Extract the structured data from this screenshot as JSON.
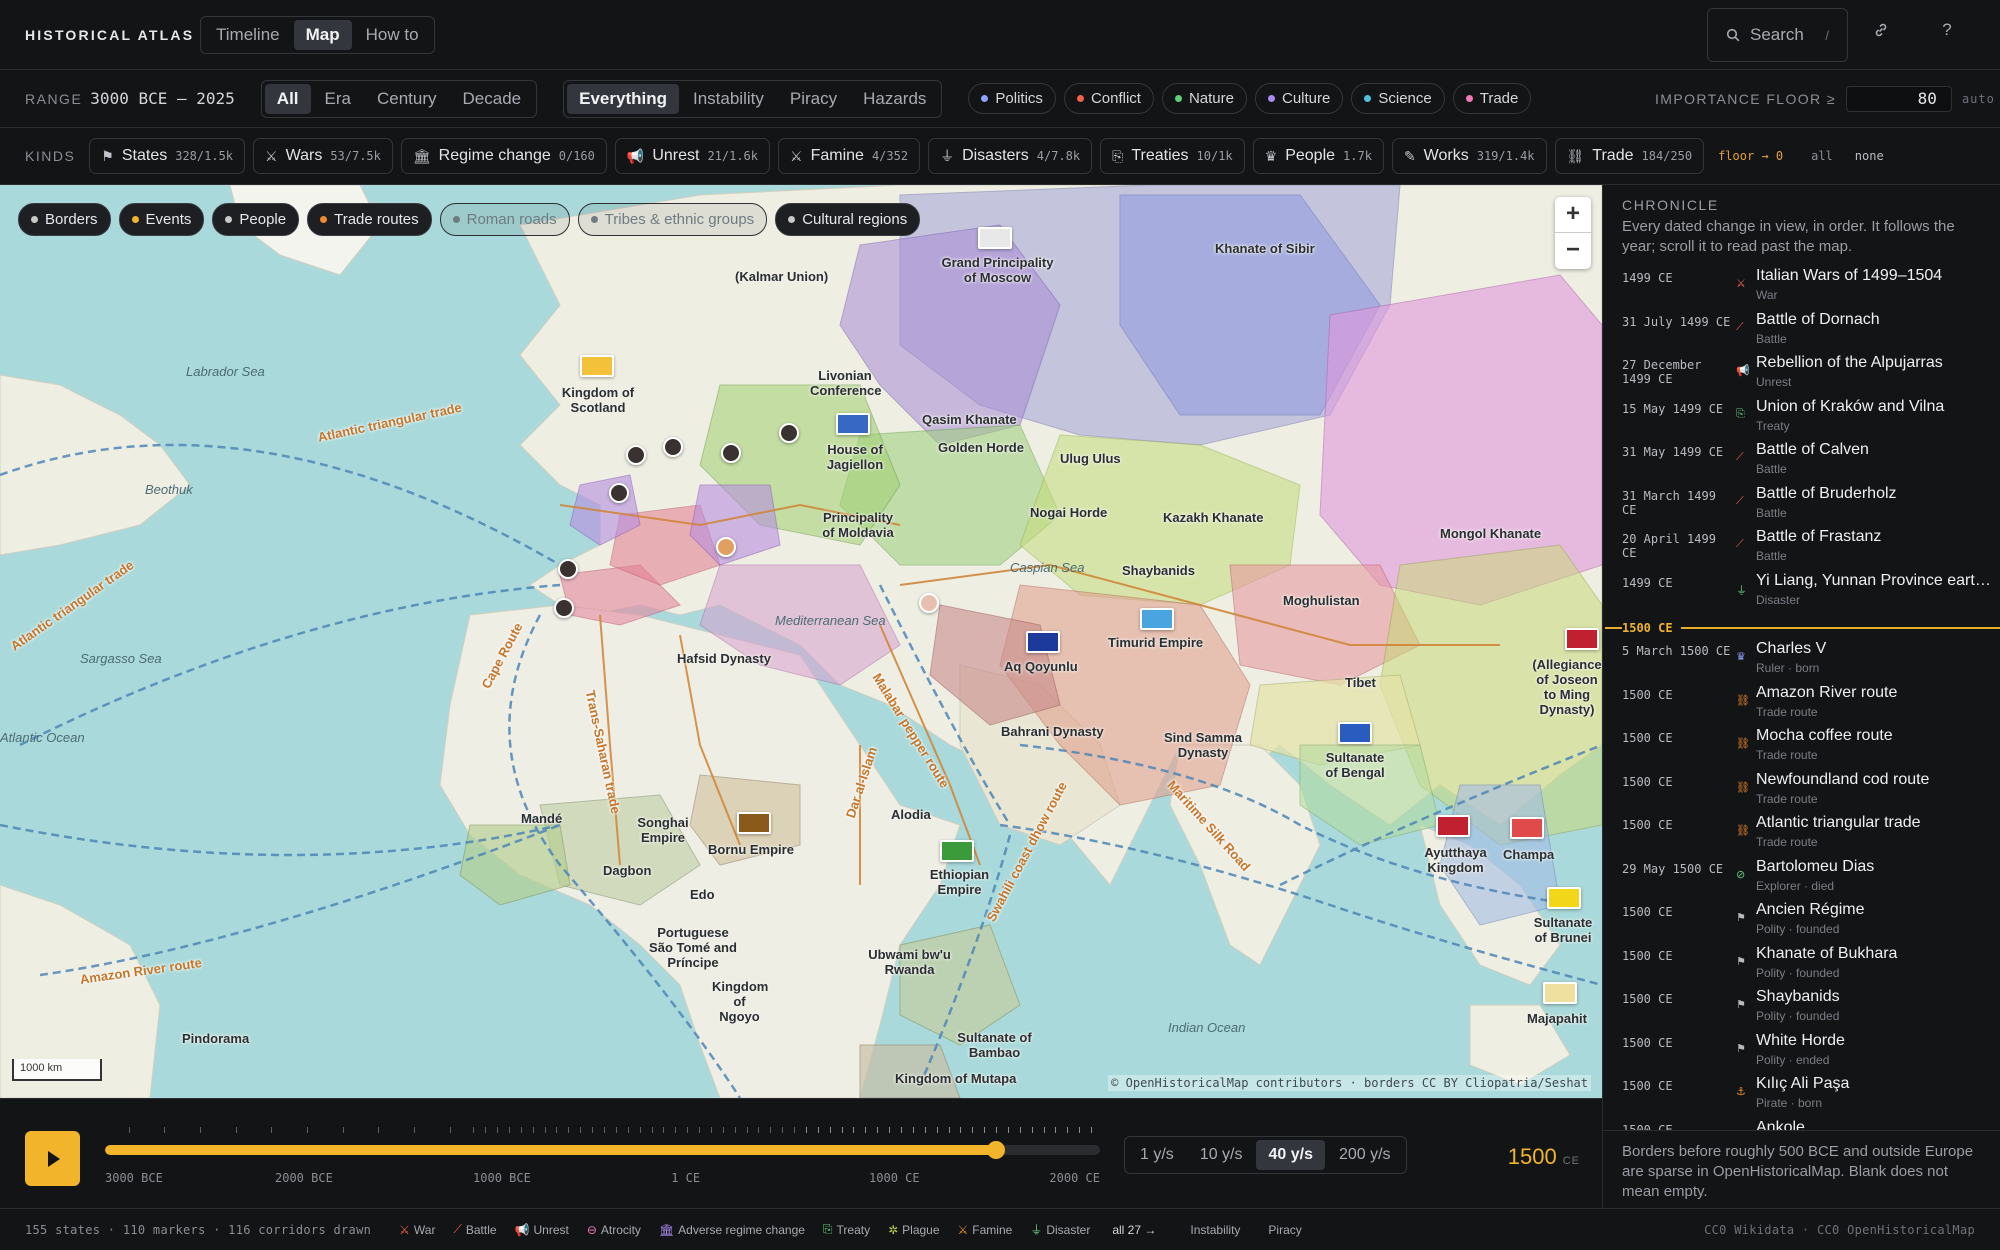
{
  "header": {
    "brand": "HISTORICAL ATLAS",
    "views": [
      "Timeline",
      "Map",
      "How to"
    ],
    "active_view": "Map",
    "search_placeholder": "Search",
    "search_shortcut": "/"
  },
  "range": {
    "label": "RANGE",
    "value": "3000 BCE — 2025",
    "granularity": [
      "All",
      "Era",
      "Century",
      "Decade"
    ],
    "active_granularity": "All",
    "lenses": [
      "Everything",
      "Instability",
      "Piracy",
      "Hazards"
    ],
    "active_lens": "Everything",
    "themes": [
      {
        "label": "Politics",
        "color": "#8ea2ff"
      },
      {
        "label": "Conflict",
        "color": "#f0624d"
      },
      {
        "label": "Nature",
        "color": "#5fcf7c"
      },
      {
        "label": "Culture",
        "color": "#a98bf0"
      },
      {
        "label": "Science",
        "color": "#4cc3d9"
      },
      {
        "label": "Trade",
        "color": "#ef7ab8"
      }
    ],
    "importance_label": "IMPORTANCE FLOOR ≥",
    "importance_value": "80",
    "importance_auto": "auto"
  },
  "kinds": {
    "label": "KINDS",
    "items": [
      {
        "label": "States",
        "count": "328/1.5k",
        "icon": "⚑"
      },
      {
        "label": "Wars",
        "count": "53/7.5k",
        "icon": "⚔"
      },
      {
        "label": "Regime change",
        "count": "0/160",
        "icon": "🏛"
      },
      {
        "label": "Unrest",
        "count": "21/1.6k",
        "icon": "📢"
      },
      {
        "label": "Famine",
        "count": "4/352",
        "icon": "⚔"
      },
      {
        "label": "Disasters",
        "count": "4/7.8k",
        "icon": "⏚"
      },
      {
        "label": "Treaties",
        "count": "10/1k",
        "icon": "⎘"
      },
      {
        "label": "People",
        "count": "1.7k",
        "icon": "♛"
      },
      {
        "label": "Works",
        "count": "319/1.4k",
        "icon": "✎"
      },
      {
        "label": "Trade",
        "count": "184/250",
        "icon": "⛓"
      }
    ],
    "floor_note": "floor → 0",
    "all_label": "all",
    "none_label": "none"
  },
  "map": {
    "layers": [
      {
        "label": "Borders",
        "on": true,
        "color": "#c9c9c9"
      },
      {
        "label": "Events",
        "on": true,
        "color": "#f1b42a"
      },
      {
        "label": "People",
        "on": true,
        "color": "#c9c9c9"
      },
      {
        "label": "Trade routes",
        "on": true,
        "color": "#f08a2a"
      },
      {
        "label": "Roman roads",
        "on": false,
        "color": "#6e7c82"
      },
      {
        "label": "Tribes & ethnic groups",
        "on": false,
        "color": "#6e7c82"
      },
      {
        "label": "Cultural regions",
        "on": true,
        "color": "#c9c9c9"
      }
    ],
    "zoom_in": "+",
    "zoom_out": "−",
    "scale": "1000 km",
    "attribution": "© OpenHistoricalMap contributors · borders CC BY Cliopatria/Seshat",
    "place_labels": [
      "(Kalmar Union)",
      "Grand Principality of Moscow",
      "Khanate of Sibir",
      "Kingdom of Scotland",
      "Livonian Conference",
      "House of Jagiellon",
      "Qasim Khanate",
      "Golden Horde",
      "Ulug Ulus",
      "Nogai Horde",
      "Kazakh Khanate",
      "Mongol Khanate",
      "Principality of Moldavia",
      "Shaybanids",
      "Moghulistan",
      "Hafsid Dynasty",
      "Aq Qoyunlu",
      "Timurid Empire",
      "Tibet",
      "Bahrani Dynasty",
      "Sultanate of Bengal",
      "Songhai Empire",
      "Bornu Empire",
      "Alodia",
      "Ethiopian Empire",
      "Ayutthaya Kingdom",
      "Champa",
      "Sultanate of Brunei",
      "Portuguese São Tomé and Príncipe",
      "Ubwami bw'u Rwanda",
      "Kingdom of Ngoyo",
      "Sultanate of Bambao",
      "Majapahit",
      "Pindorama",
      "Mandé",
      "Dagbon",
      "Edo",
      "Sind Samma Dynasty",
      "Kingdom of Mutapa",
      "(Allegiance of Joseon to Ming Dynasty)"
    ],
    "sea_labels": [
      "Labrador Sea",
      "Sargasso Sea",
      "Caspian Sea",
      "Mediterranean Sea",
      "Indian Ocean",
      "Beothuk",
      "Atlantic Ocean"
    ],
    "route_labels": [
      "Atlantic triangular trade",
      "Cape Route",
      "Trans-Saharan trade",
      "Malabar pepper route",
      "Swahili coast dhow route",
      "Maritime Silk Road",
      "Amazon River route",
      "Dar al-Islam"
    ]
  },
  "chronicle": {
    "title": "CHRONICLE",
    "description": "Every dated change in view, in order. It follows the year; scroll it to read past the map.",
    "before": [
      {
        "date": "1499 CE",
        "name": "Italian Wars of 1499–1504",
        "kind": "War",
        "icon": "⚔",
        "color": "#f0624d"
      },
      {
        "date": "31 July 1499 CE",
        "name": "Battle of Dornach",
        "kind": "Battle",
        "icon": "⟋",
        "color": "#f0624d"
      },
      {
        "date": "27 December 1499 CE",
        "name": "Rebellion of the Alpujarras",
        "kind": "Unrest",
        "icon": "📢",
        "color": "#f0624d"
      },
      {
        "date": "15 May 1499 CE",
        "name": "Union of Kraków and Vilna",
        "kind": "Treaty",
        "icon": "⎘",
        "color": "#5fcf7c"
      },
      {
        "date": "31 May 1499 CE",
        "name": "Battle of Calven",
        "kind": "Battle",
        "icon": "⟋",
        "color": "#f0624d"
      },
      {
        "date": "31 March 1499 CE",
        "name": "Battle of Bruderholz",
        "kind": "Battle",
        "icon": "⟋",
        "color": "#f0624d"
      },
      {
        "date": "20 April 1499 CE",
        "name": "Battle of Frastanz",
        "kind": "Battle",
        "icon": "⟋",
        "color": "#f0624d"
      },
      {
        "date": "1499 CE",
        "name": "Yi Liang, Yunnan Province earthquake",
        "kind": "Disaster",
        "icon": "⏚",
        "color": "#5fcf7c"
      }
    ],
    "year_marker": "1500 CE",
    "after": [
      {
        "date": "5 March 1500 CE",
        "name": "Charles V",
        "kind": "Ruler · born",
        "icon": "♛",
        "color": "#8ea2ff"
      },
      {
        "date": "1500 CE",
        "name": "Amazon River route",
        "kind": "Trade route",
        "icon": "⛓",
        "color": "#f08a2a"
      },
      {
        "date": "1500 CE",
        "name": "Mocha coffee route",
        "kind": "Trade route",
        "icon": "⛓",
        "color": "#f08a2a"
      },
      {
        "date": "1500 CE",
        "name": "Newfoundland cod route",
        "kind": "Trade route",
        "icon": "⛓",
        "color": "#f08a2a"
      },
      {
        "date": "1500 CE",
        "name": "Atlantic triangular trade",
        "kind": "Trade route",
        "icon": "⛓",
        "color": "#f08a2a"
      },
      {
        "date": "29 May 1500 CE",
        "name": "Bartolomeu Dias",
        "kind": "Explorer · died",
        "icon": "⊘",
        "color": "#5fcf7c"
      },
      {
        "date": "1500 CE",
        "name": "Ancien Régime",
        "kind": "Polity · founded",
        "icon": "⚑",
        "color": "#b9bbc0"
      },
      {
        "date": "1500 CE",
        "name": "Khanate of Bukhara",
        "kind": "Polity · founded",
        "icon": "⚑",
        "color": "#b9bbc0"
      },
      {
        "date": "1500 CE",
        "name": "Shaybanids",
        "kind": "Polity · founded",
        "icon": "⚑",
        "color": "#b9bbc0"
      },
      {
        "date": "1500 CE",
        "name": "White Horde",
        "kind": "Polity · ended",
        "icon": "⚑",
        "color": "#b9bbc0"
      },
      {
        "date": "1500 CE",
        "name": "Kılıç Ali Paşa",
        "kind": "Pirate · born",
        "icon": "⚓",
        "color": "#f08a2a"
      },
      {
        "date": "1500 CE",
        "name": "Ankole",
        "kind": "",
        "icon": "⚑",
        "color": "#b9bbc0"
      }
    ],
    "footnote": "Borders before roughly 500 BCE and outside Europe are sparse in OpenHistoricalMap. Blank does not mean empty."
  },
  "timeline": {
    "axis_labels": [
      "3000 BCE",
      "2000 BCE",
      "1000 BCE",
      "1 CE",
      "1000 CE",
      "2000 CE"
    ],
    "axis_values": [
      -3000,
      -2000,
      -1000,
      1,
      1000,
      2000
    ],
    "range_min": -3000,
    "range_max": 2025,
    "current_value": 1500,
    "speeds": [
      "1 y/s",
      "10 y/s",
      "40 y/s",
      "200 y/s"
    ],
    "active_speed": "40 y/s",
    "current_year": "1500",
    "current_era": "CE"
  },
  "status": {
    "counts": "155 states · 110 markers · 116 corridors drawn",
    "legend": [
      {
        "label": "War",
        "icon": "⚔",
        "color": "#f0624d"
      },
      {
        "label": "Battle",
        "icon": "⟋",
        "color": "#f0624d"
      },
      {
        "label": "Unrest",
        "icon": "📢",
        "color": "#f0624d"
      },
      {
        "label": "Atrocity",
        "icon": "⊖",
        "color": "#ef7ab8"
      },
      {
        "label": "Adverse regime change",
        "icon": "🏛",
        "color": "#a98bf0"
      },
      {
        "label": "Treaty",
        "icon": "⎘",
        "color": "#5fcf7c"
      },
      {
        "label": "Plague",
        "icon": "✲",
        "color": "#b7d04a"
      },
      {
        "label": "Famine",
        "icon": "⚔",
        "color": "#f08a2a"
      },
      {
        "label": "Disaster",
        "icon": "⏚",
        "color": "#5fcf7c"
      }
    ],
    "legend_all": "all 27 →",
    "instability": "Instability",
    "piracy": "Piracy",
    "credits": "CC0 Wikidata · CC0 OpenHistoricalMap"
  }
}
